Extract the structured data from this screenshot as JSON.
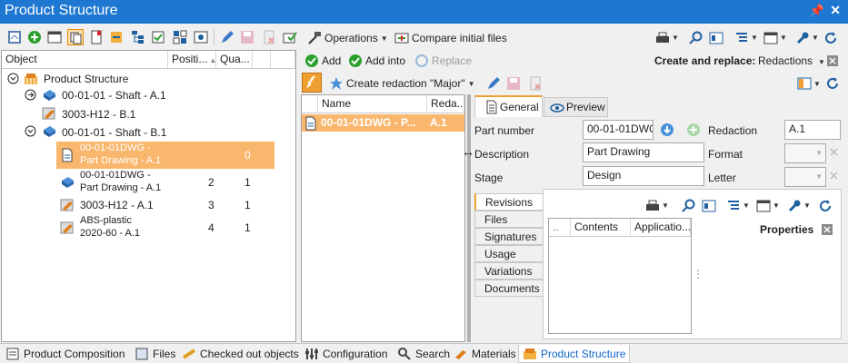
{
  "window": {
    "title": "Product Structure"
  },
  "left_toolbar": {
    "operations": "Operations",
    "compare": "Compare initial files"
  },
  "tree": {
    "columns": {
      "object": "Object",
      "position": "Positi...",
      "quantity": "Qua..."
    },
    "root": "Product Structure",
    "rows": [
      {
        "label": "00-01-01 - Shaft - A.1"
      },
      {
        "label": "3003-H12 - B.1"
      },
      {
        "label": "00-01-01 - Shaft - B.1"
      },
      {
        "label1": "00-01-01DWG -",
        "label2": "Part Drawing - A.1",
        "position": "",
        "quantity": "0"
      },
      {
        "label1": "00-01-01DWG -",
        "label2": "Part Drawing - A.1",
        "position": "2",
        "quantity": "1"
      },
      {
        "label": "3003-H12 - A.1",
        "position": "3",
        "quantity": "1"
      },
      {
        "label1": "ABS-plastic",
        "label2": "2020-60 - A.1",
        "position": "4",
        "quantity": "1"
      }
    ]
  },
  "mid_toolbar": {
    "add": "Add",
    "add_into": "Add into",
    "replace": "Replace",
    "create_redaction": "Create redaction \"Major\""
  },
  "create_replace": {
    "label": "Create and replace:",
    "value": "Redactions"
  },
  "list": {
    "columns": {
      "name": "Name",
      "redaction": "Reda..."
    },
    "rows": [
      {
        "name": "00-01-01DWG - P...",
        "redaction": "A.1"
      }
    ]
  },
  "tabs": {
    "general": "General",
    "preview": "Preview"
  },
  "form": {
    "part_number_label": "Part number",
    "part_number": "00-01-01DWG",
    "redaction_label": "Redaction",
    "redaction": "A.1",
    "description_label": "Description",
    "description": "Part Drawing",
    "format_label": "Format",
    "stage_label": "Stage",
    "stage": "Design",
    "letter_label": "Letter"
  },
  "side_tabs": [
    "Revisions",
    "Files",
    "Signatures",
    "Usage",
    "Variations",
    "Documents"
  ],
  "subgrid": {
    "col0": "..",
    "contents": "Contents",
    "applications": "Applicatio..."
  },
  "properties": {
    "title": "Properties"
  },
  "bottom_tabs": [
    "Product Composition",
    "Files",
    "Checked out objects",
    "Configuration",
    "Search",
    "Materials",
    "Product Structure"
  ],
  "colors": {
    "title_bar": "#1e78d2",
    "selection": "#f9b76e",
    "active_tab": "#0e64c8"
  }
}
